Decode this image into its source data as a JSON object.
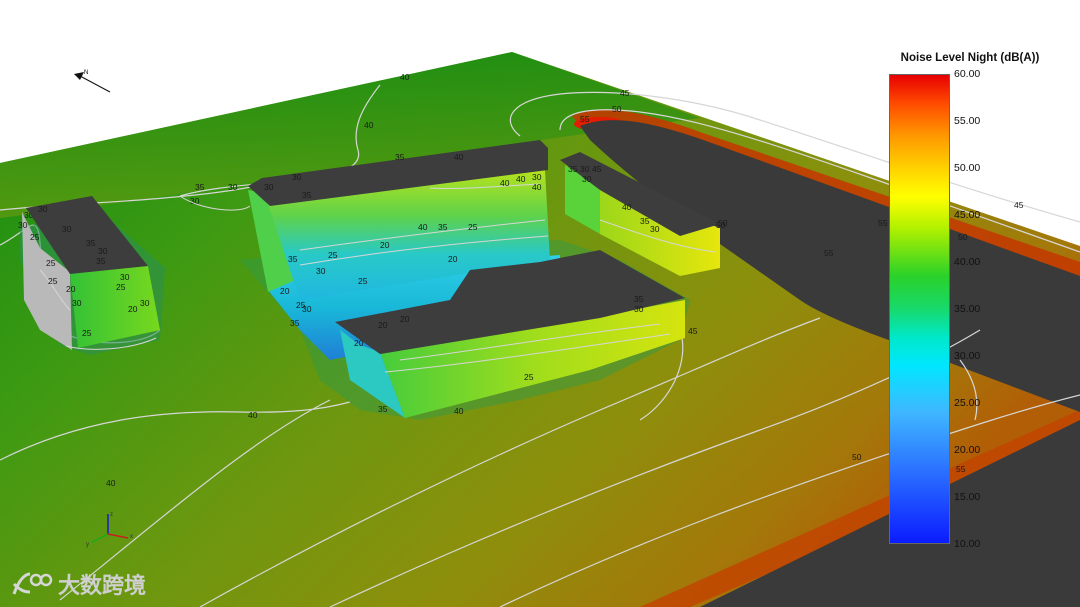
{
  "legend": {
    "title": "Noise Level Night (dB(A))",
    "ticks": [
      "60.00",
      "55.00",
      "50.00",
      "45.00",
      "40.00",
      "35.00",
      "30.00",
      "25.00",
      "20.00",
      "15.00",
      "10.00"
    ],
    "min": 10,
    "max": 60
  },
  "contours": {
    "terrain": [
      "45",
      "50",
      "55",
      "40",
      "35",
      "30",
      "30",
      "30",
      "40",
      "40",
      "50",
      "55",
      "45",
      "50",
      "55",
      "40",
      "50",
      "55"
    ],
    "building": [
      "30",
      "35",
      "40",
      "30",
      "35",
      "40",
      "40",
      "30",
      "40",
      "35",
      "30",
      "30",
      "45",
      "40",
      "35",
      "30",
      "50",
      "25",
      "40",
      "35",
      "25",
      "20",
      "35",
      "20",
      "30",
      "20",
      "25",
      "35",
      "30",
      "25",
      "20",
      "20",
      "35",
      "30",
      "45",
      "25",
      "35",
      "40",
      "20",
      "30",
      "30",
      "35",
      "30",
      "25",
      "20",
      "25",
      "30",
      "30",
      "35",
      "30",
      "25",
      "30",
      "20",
      "25",
      "25"
    ]
  },
  "north_label": "N",
  "axes": {
    "x": "x",
    "y": "y",
    "z": "z"
  },
  "watermark": {
    "text": "大数跨境"
  },
  "colors": {
    "ground_quiet": "#1e9a1e",
    "ground_mid": "#7a9a10",
    "ground_loud": "#c04400",
    "road": "#3a3a3a",
    "roof": "#3d3d3d",
    "contour": "#d6d6d6"
  }
}
